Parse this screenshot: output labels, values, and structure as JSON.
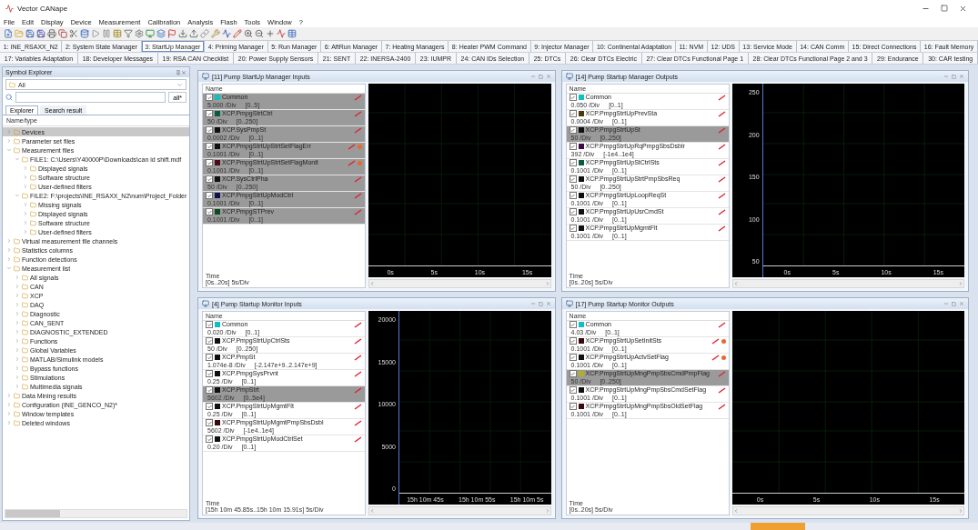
{
  "window": {
    "title": "Vector CANape"
  },
  "menu": [
    "File",
    "Edit",
    "Display",
    "Device",
    "Measurement",
    "Calibration",
    "Analysis",
    "Flash",
    "Tools",
    "Window",
    "?"
  ],
  "tab_rows": [
    [
      {
        "label": "1: INE_RSAXX_N2",
        "selected": false
      },
      {
        "label": "2: System State Manager",
        "selected": false
      },
      {
        "label": "3: StartUp Manager",
        "selected": true
      },
      {
        "label": "4: Priming Manager",
        "selected": false
      },
      {
        "label": "5: Run Manager",
        "selected": false
      },
      {
        "label": "6: AftRun Manager",
        "selected": false
      },
      {
        "label": "7: Heating Managers",
        "selected": false
      },
      {
        "label": "8: Heater PWM Command",
        "selected": false
      },
      {
        "label": "9: Injector Manager",
        "selected": false
      },
      {
        "label": "10: Continental Adaptation",
        "selected": false
      },
      {
        "label": "11: NVM",
        "selected": false
      },
      {
        "label": "12: UDS",
        "selected": false
      },
      {
        "label": "13: Service Mode",
        "selected": false
      },
      {
        "label": "14: CAN Comm",
        "selected": false
      },
      {
        "label": "15: Direct Connections",
        "selected": false
      },
      {
        "label": "16: Fault Memory",
        "selected": false
      }
    ],
    [
      {
        "label": "17: Variables Adaptation",
        "selected": false
      },
      {
        "label": "18: Developer Messages",
        "selected": false
      },
      {
        "label": "19: RSA CAN Checklist",
        "selected": false
      },
      {
        "label": "20: Power Supply Sensors",
        "selected": false
      },
      {
        "label": "21: SENT",
        "selected": false
      },
      {
        "label": "22: INERSA-2400",
        "selected": false
      },
      {
        "label": "23: IUMPR",
        "selected": false
      },
      {
        "label": "24: CAN IDs Selection",
        "selected": false
      },
      {
        "label": "25: DTCs",
        "selected": false
      },
      {
        "label": "26: Clear DTCs Electric",
        "selected": false
      },
      {
        "label": "27: Clear DTCs Functional Page 1",
        "selected": false
      },
      {
        "label": "28: Clear DTCs Functional Page 2 and 3",
        "selected": false
      },
      {
        "label": "29: Endurance",
        "selected": false
      },
      {
        "label": "30: CAR testing",
        "selected": false
      }
    ]
  ],
  "symbol_explorer": {
    "title": "Symbol Explorer",
    "filter": "All",
    "search_option": "all*",
    "tabs": [
      {
        "label": "Explorer",
        "selected": true
      },
      {
        "label": "Search result",
        "selected": false
      }
    ],
    "column": "Name/type",
    "tree": [
      {
        "label": "Devices",
        "selected": true,
        "expanded": false
      },
      {
        "label": "Parameter set files",
        "selected": false,
        "expanded": false
      },
      {
        "label": "Measurement files",
        "selected": false,
        "expanded": true,
        "children": [
          {
            "label": "FILE1: C:\\Users\\Y40000P\\Downloads\\can id shift.mdf",
            "selected": false,
            "expanded": true,
            "children": [
              {
                "label": "Displayed signals",
                "selected": false,
                "expanded": false
              },
              {
                "label": "Software structure",
                "selected": false,
                "expanded": false
              },
              {
                "label": "User-defined filters",
                "selected": false,
                "expanded": false
              }
            ]
          },
          {
            "label": "FILE2: F:\\projects\\INE_RSAXX_N2\\num\\Project_Folder",
            "selected": false,
            "expanded": true,
            "children": [
              {
                "label": "Missing signals",
                "selected": false,
                "expanded": false
              },
              {
                "label": "Displayed signals",
                "selected": false,
                "expanded": false
              },
              {
                "label": "Software structure",
                "selected": false,
                "expanded": false
              },
              {
                "label": "User-defined filters",
                "selected": false,
                "expanded": false
              }
            ]
          }
        ]
      },
      {
        "label": "Virtual measurement file channels",
        "selected": false,
        "expanded": false
      },
      {
        "label": "Statistics columns",
        "selected": false,
        "expanded": false
      },
      {
        "label": "Function detections",
        "selected": false,
        "expanded": false
      },
      {
        "label": "Measurement list",
        "selected": false,
        "expanded": true,
        "children": [
          {
            "label": "All signals",
            "selected": false,
            "expanded": false
          },
          {
            "label": "CAN",
            "selected": false,
            "expanded": false
          },
          {
            "label": "XCP",
            "selected": false,
            "expanded": false
          },
          {
            "label": "DAQ",
            "selected": false,
            "expanded": false
          },
          {
            "label": "Diagnostic",
            "selected": false,
            "expanded": false
          },
          {
            "label": "CAN_SENT",
            "selected": false,
            "expanded": false
          },
          {
            "label": "DIAGNOSTIC_EXTENDED",
            "selected": false,
            "expanded": false
          },
          {
            "label": "Functions",
            "selected": false,
            "expanded": false
          },
          {
            "label": "Global Variables",
            "selected": false,
            "expanded": false
          },
          {
            "label": "MATLAB/Simulink models",
            "selected": false,
            "expanded": false
          },
          {
            "label": "Bypass functions",
            "selected": false,
            "expanded": false
          },
          {
            "label": "Stimulations",
            "selected": false,
            "expanded": false
          },
          {
            "label": "Multimedia signals",
            "selected": false,
            "expanded": false
          }
        ]
      },
      {
        "label": "Data Mining results",
        "selected": false,
        "expanded": false
      },
      {
        "label": "Configuration (INE_GENCO_N2)*",
        "selected": false,
        "expanded": false
      },
      {
        "label": "Window templates",
        "selected": false,
        "expanded": false
      },
      {
        "label": "Deleted windows",
        "selected": false,
        "expanded": false
      }
    ]
  },
  "windows": [
    {
      "title": "[11] Pump StartUp Manager Inputs",
      "column": "Name",
      "time_label": "Time",
      "time_range": "[0s..20s] 5s/Div",
      "x_ticks": [
        "0s",
        "5s",
        "10s",
        "15s"
      ],
      "signals": [
        {
          "name": "Common",
          "scale": "5.000 /Div",
          "range": "[0..5]",
          "selected": true,
          "checked": true,
          "color": "#10c0c0",
          "warning": false
        },
        {
          "name": "XCP.PmpgStrtCtrl",
          "scale": "50 /Div",
          "range": "[0..250]",
          "selected": true,
          "checked": true,
          "color": "#0a5a40",
          "warning": false
        },
        {
          "name": "XCP.SysPmpSt",
          "scale": "0.0002 /Div",
          "range": "[0..1]",
          "selected": true,
          "checked": true,
          "color": "#101010",
          "warning": false
        },
        {
          "name": "XCP.PmpgStrtUpStrtSetFlagErr",
          "scale": "0.1001 /Div",
          "range": "[0..1]",
          "selected": true,
          "checked": true,
          "color": "#101010",
          "warning": true
        },
        {
          "name": "XCP.PmpgStrtUpStrtSetFlagMonit",
          "scale": "0.1001 /Div",
          "range": "[0..1]",
          "selected": true,
          "checked": true,
          "color": "#4a0a1a",
          "warning": true
        },
        {
          "name": "XCP.SysCtrlPha",
          "scale": "50 /Div",
          "range": "[0..250]",
          "selected": true,
          "checked": true,
          "color": "#101010",
          "warning": false
        },
        {
          "name": "XCP.PmpgStrtUpModCtrl",
          "scale": "0.1001 /Div",
          "range": "[0..1]",
          "selected": true,
          "checked": true,
          "color": "#10104a",
          "warning": false
        },
        {
          "name": "XCP.PmpgSTPrev",
          "scale": "0.1001 /Div",
          "range": "[0..1]",
          "selected": true,
          "checked": true,
          "color": "#0a4a20",
          "warning": false
        }
      ]
    },
    {
      "title": "[14] Pump Startup Manager Outputs",
      "column": "Name",
      "time_label": "Time",
      "time_range": "[0s..20s] 5s/Div",
      "y_ticks": [
        "250",
        "200",
        "150",
        "100",
        "50"
      ],
      "x_ticks": [
        "0s",
        "5s",
        "10s",
        "15s"
      ],
      "signals": [
        {
          "name": "Common",
          "scale": "0.050 /Div",
          "range": "[0..1]",
          "selected": false,
          "checked": true,
          "color": "#10c0c0",
          "warning": false
        },
        {
          "name": "XCP.PmpgStrtUpPrevSta",
          "scale": "0.0004 /Div",
          "range": "[0..1]",
          "selected": false,
          "checked": true,
          "color": "#4a3a10",
          "warning": false
        },
        {
          "name": "XCP.PmpgStrtUpSt",
          "scale": "50 /Div",
          "range": "[0..250]",
          "selected": true,
          "checked": true,
          "color": "#101010",
          "warning": false
        },
        {
          "name": "XCP.PmpgStrtUpRqPmpgSbsDsblr",
          "scale": "392 /Div",
          "range": "[-1e4..1e4]",
          "selected": false,
          "checked": true,
          "color": "#3a0a4a",
          "warning": false
        },
        {
          "name": "XCP.PmpgStrtUpStCtrlSts",
          "scale": "0.1001 /Div",
          "range": "[0..1]",
          "selected": false,
          "checked": true,
          "color": "#0a5a40",
          "warning": false
        },
        {
          "name": "XCP.PmpgStrtUpStrtPmpSbsReq",
          "scale": "50 /Div",
          "range": "[0..250]",
          "selected": false,
          "checked": true,
          "color": "#101010",
          "warning": false
        },
        {
          "name": "XCP.PmpgStrtUpLoopReqSt",
          "scale": "0.1001 /Div",
          "range": "[0..1]",
          "selected": false,
          "checked": true,
          "color": "#101010",
          "warning": false
        },
        {
          "name": "XCP.PmpgStrtUpUsrCmdSt",
          "scale": "0.1001 /Div",
          "range": "[0..1]",
          "selected": false,
          "checked": true,
          "color": "#101010",
          "warning": false
        },
        {
          "name": "XCP.PmpgStrtUpMgmtFlt",
          "scale": "0.1001 /Div",
          "range": "[0..1]",
          "selected": false,
          "checked": true,
          "color": "#101010",
          "warning": false
        }
      ]
    },
    {
      "title": "[4] Pump Startup Monitor Inputs",
      "column": "Name",
      "time_label": "Time",
      "time_range": "[15h 10m 45.85s..15h 10m 15.91s] 5s/Div",
      "y_ticks": [
        "20000",
        "15000",
        "10000",
        "5000",
        "0"
      ],
      "x_ticks": [
        "15h 10m 45s",
        "15h 10m 55s",
        "15h 10m 5s"
      ],
      "signals": [
        {
          "name": "Common",
          "scale": "0.020 /Div",
          "range": "[0..1]",
          "selected": false,
          "checked": true,
          "color": "#10c0c0",
          "warning": false
        },
        {
          "name": "XCP.PmpgStrtUpCtrlSts",
          "scale": "50 /Div",
          "range": "[0..250]",
          "selected": false,
          "checked": true,
          "color": "#101010",
          "warning": false
        },
        {
          "name": "XCP.PmpSt",
          "scale": "1.074e-8 /Div",
          "range": "[-2.147e+9..2.147e+9]",
          "selected": false,
          "checked": true,
          "color": "#101010",
          "warning": false
        },
        {
          "name": "XCP.PmpgSysPrvnt",
          "scale": "0.25 /Div",
          "range": "[0..1]",
          "selected": false,
          "checked": true,
          "color": "#101010",
          "warning": false
        },
        {
          "name": "XCP.PmpStrt",
          "scale": "5602 /Div",
          "range": "[0..5e4]",
          "selected": true,
          "checked": true,
          "color": "#101010",
          "warning": false
        },
        {
          "name": "XCP.PmpgStrtUpMgmtFlt",
          "scale": "0.25 /Div",
          "range": "[0..1]",
          "selected": false,
          "checked": true,
          "color": "#101010",
          "warning": false
        },
        {
          "name": "XCP.PmpgStrtUpMgmtPmpSbsDsbl",
          "scale": "5602 /Div",
          "range": "[-1e4..1e4]",
          "selected": false,
          "checked": true,
          "color": "#3a0a0a",
          "warning": false
        },
        {
          "name": "XCP.PmpgStrtUpModCtrlSet",
          "scale": "0.20 /Div",
          "range": "[0..1]",
          "selected": false,
          "checked": true,
          "color": "#101010",
          "warning": false
        }
      ]
    },
    {
      "title": "[17] Pump Startup Monitor Outputs",
      "column": "Name",
      "time_label": "Time",
      "time_range": "[0s..20s] 5s/Div",
      "x_ticks": [
        "0s",
        "5s",
        "10s",
        "15s"
      ],
      "signals": [
        {
          "name": "Common",
          "scale": "4.03 /Div",
          "range": "[0..1]",
          "selected": false,
          "checked": true,
          "color": "#10c0c0",
          "warning": false
        },
        {
          "name": "XCP.PmpgStrtUpSetInitSts",
          "scale": "0.1001 /Div",
          "range": "[0..1]",
          "selected": false,
          "checked": true,
          "color": "#3a0a0a",
          "warning": true
        },
        {
          "name": "XCP.PmpgStrtUpActvSetFlag",
          "scale": "0.1001 /Div",
          "range": "[0..1]",
          "selected": false,
          "checked": true,
          "color": "#101010",
          "warning": true
        },
        {
          "name": "XCP.PmpgStrtUpMngPmpSbsCmdPmpFlag",
          "scale": "50 /Div",
          "range": "[0..250]",
          "selected": true,
          "checked": true,
          "color": "#b0b020",
          "warning": false
        },
        {
          "name": "XCP.PmpgStrtUpMngPmpSbsCmdSetFlag",
          "scale": "0.1001 /Div",
          "range": "[0..1]",
          "selected": false,
          "checked": true,
          "color": "#101010",
          "warning": false
        },
        {
          "name": "XCP.PmpgStrtUpMngPmpSbsOldSetFlag",
          "scale": "0.1001 /Div",
          "range": "[0..1]",
          "selected": false,
          "checked": true,
          "color": "#3a0a0a",
          "warning": false
        }
      ]
    }
  ]
}
